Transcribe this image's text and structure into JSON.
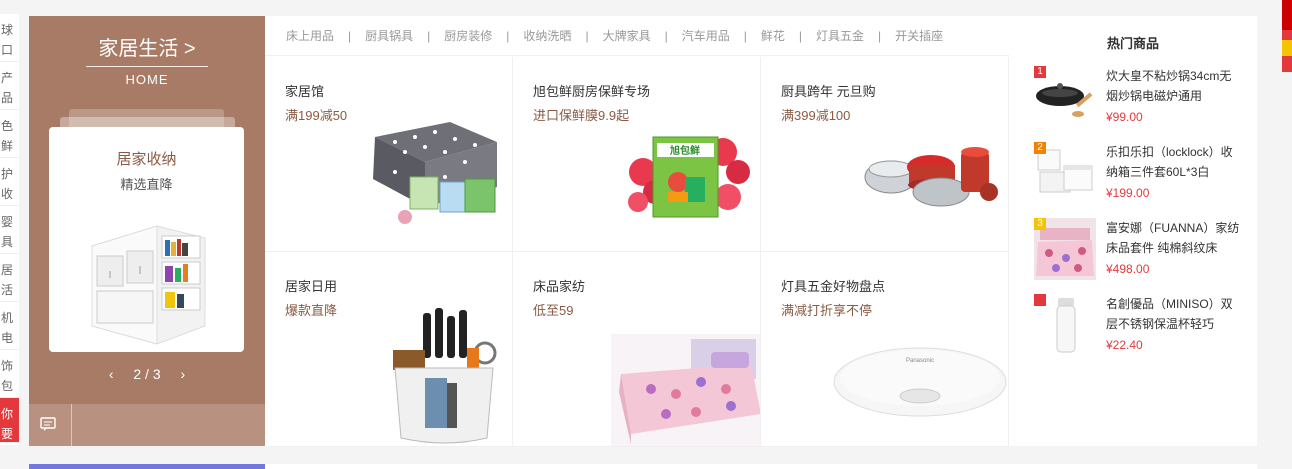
{
  "left_nav": [
    "球\n口",
    "产\n品",
    "色\n鲜",
    "护\n收",
    "婴\n具",
    "居\n活",
    "机\n电",
    "饰\n包",
    "你\n要"
  ],
  "banner": {
    "title": "家居生活 >",
    "subtitle": "HOME",
    "card_title": "居家收纳",
    "card_sub": "精选直降",
    "prev": "‹",
    "page": "2 / 3",
    "next": "›",
    "bg_color": "#a77b66"
  },
  "categories": [
    "床上用品",
    "厨具锅具",
    "厨房装修",
    "收纳洗晒",
    "大牌家具",
    "汽车用品",
    "鲜花",
    "灯具五金",
    "开关插座"
  ],
  "separator": "|",
  "cells": [
    {
      "title": "家居馆",
      "sub": "满199减50",
      "icon": "bedding-set-image"
    },
    {
      "title": "旭包鲜厨房保鲜专场",
      "sub": "进口保鲜膜9.9起",
      "icon": "cling-film-box-image",
      "pack_text": "旭包鲜"
    },
    {
      "title": "厨具跨年 元旦购",
      "sub": "满399减100",
      "icon": "cookware-set-image"
    },
    {
      "title": "居家日用",
      "sub": "爆款直降",
      "icon": "knife-block-image"
    },
    {
      "title": "床品家纺",
      "sub": "低至59",
      "icon": "floral-bedding-image"
    },
    {
      "title": "灯具五金好物盘点",
      "sub": "满减打折享不停",
      "icon": "ceiling-lamp-image"
    }
  ],
  "hot": {
    "title": "热门商品",
    "items": [
      {
        "rank": "1",
        "rank_color": "#e4393c",
        "name": "炊大皇不粘炒锅34cm无烟炒锅电磁炉通用",
        "price": "¥99.00",
        "icon": "wok-image"
      },
      {
        "rank": "2",
        "rank_color": "#f08300",
        "name": "乐扣乐扣（locklock）收纳箱三件套60L*3白",
        "price": "¥199.00",
        "icon": "storage-box-image"
      },
      {
        "rank": "3",
        "rank_color": "#f5c400",
        "name": "富安娜（FUANNA）家纺床品套件 纯棉斜纹床",
        "price": "¥498.00",
        "icon": "bed-set-image"
      },
      {
        "rank": "",
        "rank_color": "#e4393c",
        "name": "名創優品（MINISO）双层不锈钢保温杯轻巧",
        "price": "¥22.40",
        "icon": "thermos-image"
      }
    ]
  }
}
